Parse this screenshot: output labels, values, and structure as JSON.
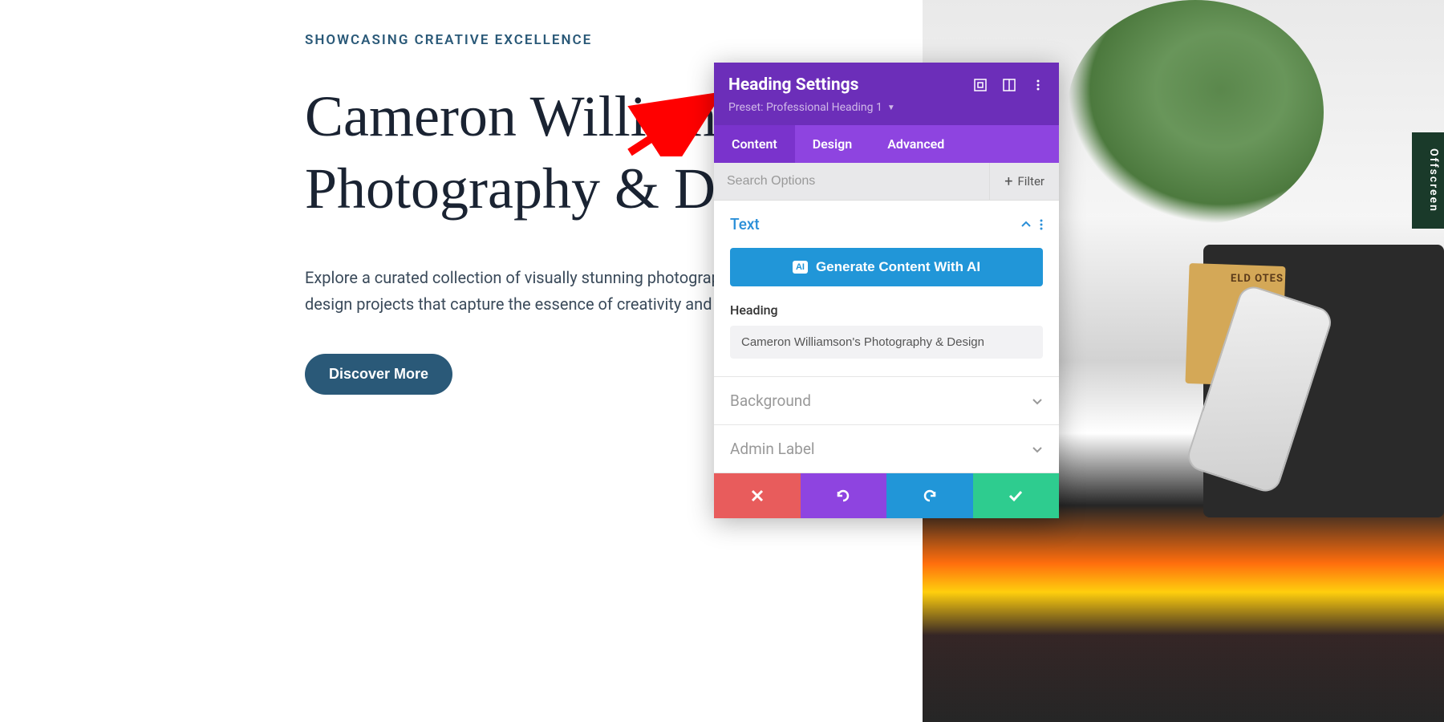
{
  "page": {
    "eyebrow": "SHOWCASING CREATIVE EXCELLENCE",
    "heading": "Cameron Williamson's Photography & Design",
    "description": "Explore a curated collection of visually stunning photographs and innovative design projects that capture the essence of creativity and precision.",
    "cta": "Discover More"
  },
  "bg": {
    "book_spine": "Offscreen",
    "notes": "ELD\nOTES"
  },
  "panel": {
    "title": "Heading Settings",
    "preset_label": "Preset: Professional Heading 1",
    "tabs": {
      "content": "Content",
      "design": "Design",
      "advanced": "Advanced"
    },
    "search_placeholder": "Search Options",
    "filter": "Filter",
    "sections": {
      "text": {
        "title": "Text",
        "ai_button": "Generate Content With AI",
        "ai_badge": "AI",
        "heading_label": "Heading",
        "heading_value": "Cameron Williamson's Photography & Design"
      },
      "background": {
        "title": "Background"
      },
      "admin": {
        "title": "Admin Label"
      }
    }
  }
}
